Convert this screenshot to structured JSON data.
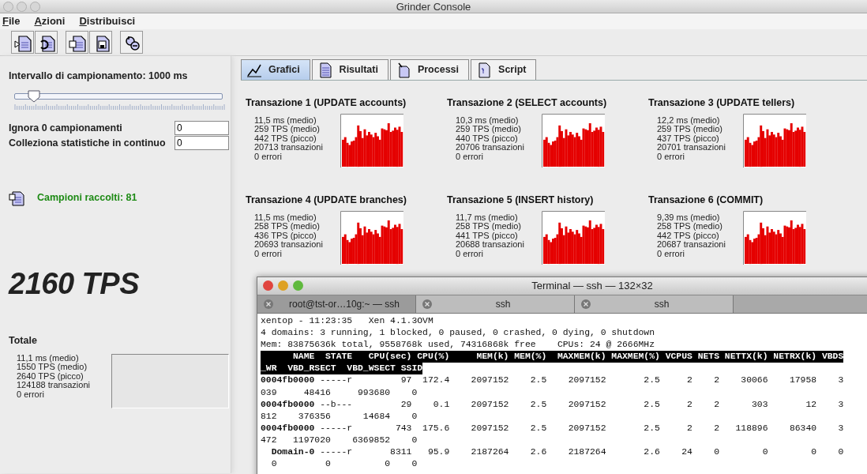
{
  "window": {
    "title": "Grinder Console"
  },
  "menu": [
    {
      "label": "File"
    },
    {
      "label": "Azioni"
    },
    {
      "label": "Distribuisci"
    }
  ],
  "toolbar_groups": [
    [
      {
        "kind": "start"
      },
      {
        "kind": "reset"
      }
    ],
    [
      {
        "kind": "open"
      },
      {
        "kind": "save"
      }
    ],
    [
      {
        "kind": "distribute"
      }
    ]
  ],
  "sampling": {
    "label": "Intervallo di campionamento: 1000 ms",
    "level": 0.09
  },
  "fields": [
    {
      "label": "Ignora 0 campionamenti",
      "value": "0"
    },
    {
      "label": "Colleziona statistiche in continuo",
      "value": "0"
    }
  ],
  "samples_collected": "Campioni raccolti: 81",
  "tps": "2160 TPS",
  "total": {
    "title": "Totale",
    "stats": [
      "11,1 ms (medio)",
      "1550 TPS (medio)",
      "2640 TPS (picco)",
      "124188 transazioni",
      "0 errori"
    ]
  },
  "tabs": [
    {
      "label": "Grafici",
      "kind": "chart",
      "selected": true
    },
    {
      "label": "Risultati",
      "kind": "table",
      "selected": false
    },
    {
      "label": "Processi",
      "kind": "process",
      "selected": false
    },
    {
      "label": "Script",
      "kind": "script",
      "selected": false
    }
  ],
  "transactions": [
    {
      "title": "Transazione 1 (UPDATE accounts)",
      "stats": [
        "11,5 ms (medio)",
        "259 TPS (medio)",
        "442 TPS (picco)",
        "20713 transazioni",
        "0 errori"
      ]
    },
    {
      "title": "Transazione 2 (SELECT accounts)",
      "stats": [
        "10,3 ms (medio)",
        "259 TPS (medio)",
        "440 TPS (picco)",
        "20706 transazioni",
        "0 errori"
      ]
    },
    {
      "title": "Transazione 3 (UPDATE tellers)",
      "stats": [
        "12,2 ms (medio)",
        "259 TPS (medio)",
        "437 TPS (picco)",
        "20701 transazioni",
        "0 errori"
      ]
    },
    {
      "title": "Transazione 4 (UPDATE branches)",
      "stats": [
        "11,5 ms (medio)",
        "258 TPS (medio)",
        "436 TPS (picco)",
        "20693 transazioni",
        "0 errori"
      ]
    },
    {
      "title": "Transazione 5 (INSERT history)",
      "stats": [
        "11,7 ms (medio)",
        "258 TPS (medio)",
        "441 TPS (picco)",
        "20688 transazioni",
        "0 errori"
      ]
    },
    {
      "title": "Transazione 6 (COMMIT)",
      "stats": [
        "9,39 ms (medio)",
        "258 TPS (medio)",
        "442 TPS (picco)",
        "20687 transazioni",
        "0 errori"
      ]
    }
  ],
  "terminal": {
    "title": "Terminal — ssh — 132×32",
    "tabs": [
      {
        "label": "root@tst-or…10g:~ — ssh",
        "selected": true
      },
      {
        "label": "ssh",
        "selected": false
      },
      {
        "label": "ssh",
        "selected": false
      }
    ],
    "lines": [
      {
        "kind": "text",
        "text": "xentop - 11:23:35   Xen 4.1.3OVM"
      },
      {
        "kind": "text",
        "text": "4 domains: 3 running, 1 blocked, 0 paused, 0 crashed, 0 dying, 0 shutdown"
      },
      {
        "kind": "text",
        "text": "Mem: 83875636k total, 9558768k used, 74316868k free    CPUs: 24 @ 2666MHz"
      },
      {
        "kind": "header",
        "text": "      NAME  STATE   CPU(sec) CPU(%)     MEM(k) MEM(%)  MAXMEM(k) MAXMEM(%) VCPUS NETS NETTX(k) NETRX(k) VBDS"
      },
      {
        "kind": "header",
        "text": "_WR  VBD_RSECT  VBD_WSECT SSID"
      },
      {
        "kind": "domain",
        "name": "0004fb0000",
        "text": " -----r         97  172.4    2097152    2.5    2097152       2.5     2    2    30066    17958    3"
      },
      {
        "kind": "text",
        "text": "039     48416     993680    0"
      },
      {
        "kind": "domain",
        "name": "0004fb0000",
        "text": " --b---         29    0.1    2097152    2.5    2097152       2.5     2    2      303       12    3"
      },
      {
        "kind": "text",
        "text": "812    376356      14684    0"
      },
      {
        "kind": "domain",
        "name": "0004fb0000",
        "text": " -----r        743  175.6    2097152    2.5    2097152       2.5     2    2   118896    86340    3"
      },
      {
        "kind": "text",
        "text": "472   1197020    6369852    0"
      },
      {
        "kind": "domain",
        "name": "  Domain-0",
        "text": " -----r       8311   95.9    2187264    2.6    2187264       2.6    24    0        0        0    0"
      },
      {
        "kind": "text",
        "text": "  0         0          0    0"
      }
    ]
  }
}
